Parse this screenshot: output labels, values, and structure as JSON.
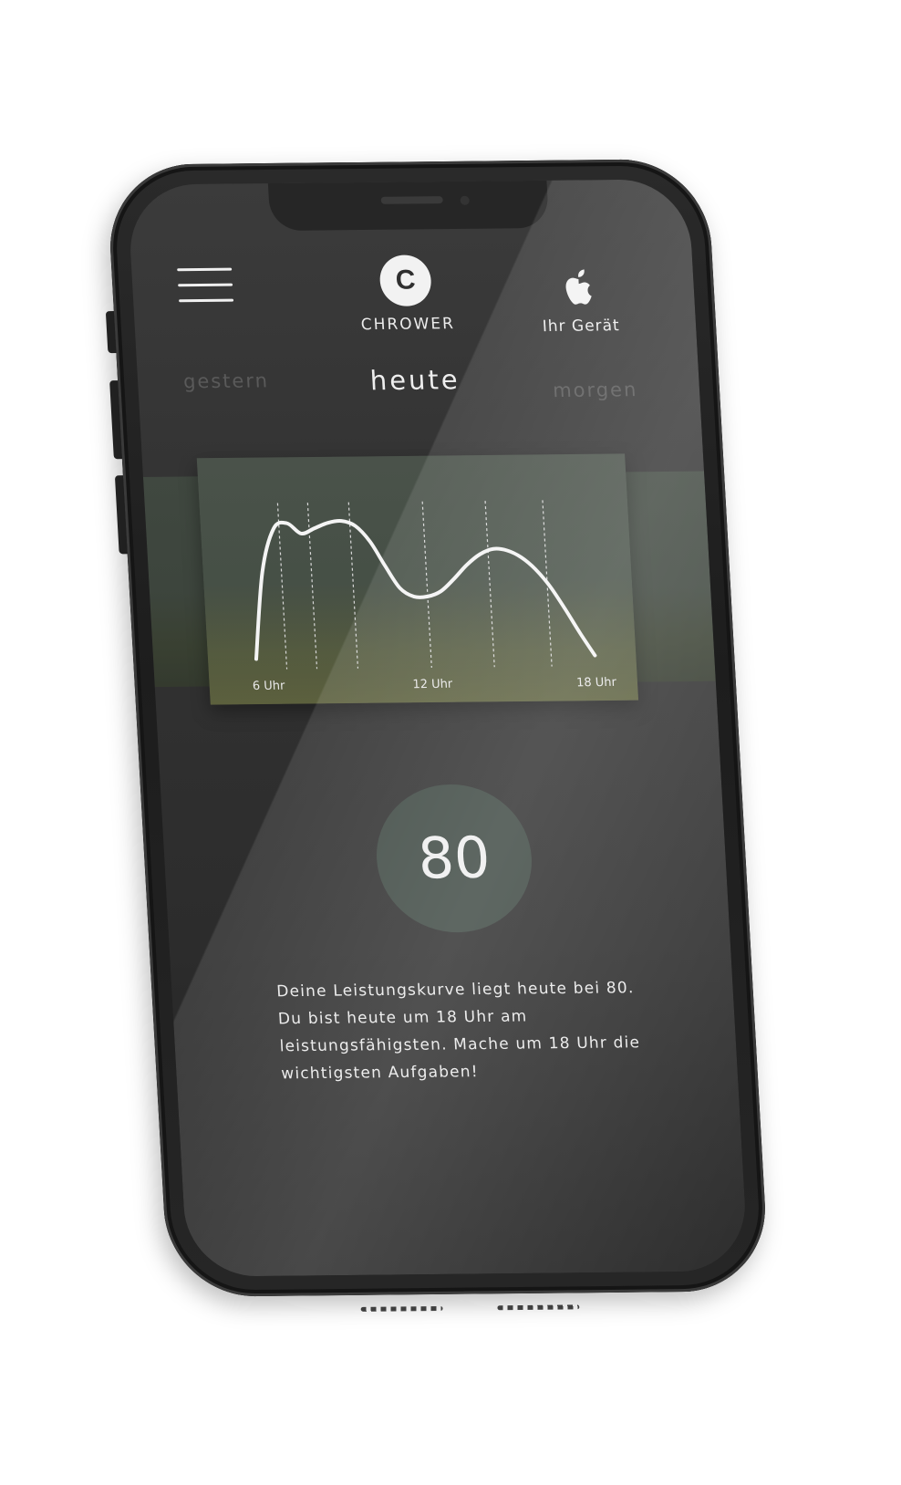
{
  "header": {
    "menu_icon": "hamburger-menu-icon",
    "brand_logo_letter": "C",
    "brand_name": "CHROWER",
    "device_icon": "apple-icon",
    "device_label": "Ihr Gerät"
  },
  "day_tabs": {
    "yesterday": "gestern",
    "today": "heute",
    "tomorrow": "morgen",
    "selected": "heute"
  },
  "chart_data": {
    "type": "line",
    "xlabel": "",
    "ylabel": "",
    "xlim": [
      4.5,
      19
    ],
    "ylim": [
      0,
      100
    ],
    "tick_labels": [
      {
        "x": 6,
        "label": "6 Uhr"
      },
      {
        "x": 12,
        "label": "12 Uhr"
      },
      {
        "x": 18,
        "label": "18 Uhr"
      }
    ],
    "gridlines_x": [
      6.7,
      7.8,
      9.3,
      12.0,
      14.3,
      16.4
    ],
    "series": [
      {
        "x": [
          5.6,
          6.0,
          6.5,
          7.0,
          7.5,
          8.0,
          8.5,
          9.0,
          9.5,
          10.0,
          10.5,
          11.0,
          11.5,
          12.0,
          12.5,
          13.0,
          13.5,
          14.0,
          14.5,
          15.0,
          15.5,
          16.0,
          16.5,
          17.0,
          17.5,
          18.0
        ],
        "y": [
          5,
          55,
          80,
          83,
          77,
          80,
          83,
          84,
          81,
          72,
          58,
          45,
          40,
          40,
          43,
          50,
          58,
          64,
          67,
          66,
          62,
          55,
          45,
          32,
          18,
          5
        ]
      }
    ],
    "colors": {
      "line": "#f4f4f4",
      "gridline": "#d8d8d8"
    }
  },
  "score": {
    "value": "80",
    "color": "#3b4640"
  },
  "summary": {
    "text": "Deine Leistungskurve liegt heute bei 80. Du bist heute um 18 Uhr am leistungsfähigsten. Mache um 18 Uhr die wichtigsten Aufgaben!"
  },
  "colors": {
    "phone_body": "#1f1f1f",
    "screen_bg": "#333333",
    "text_primary": "#eeeeee",
    "text_inactive": "#5a5a5a"
  }
}
